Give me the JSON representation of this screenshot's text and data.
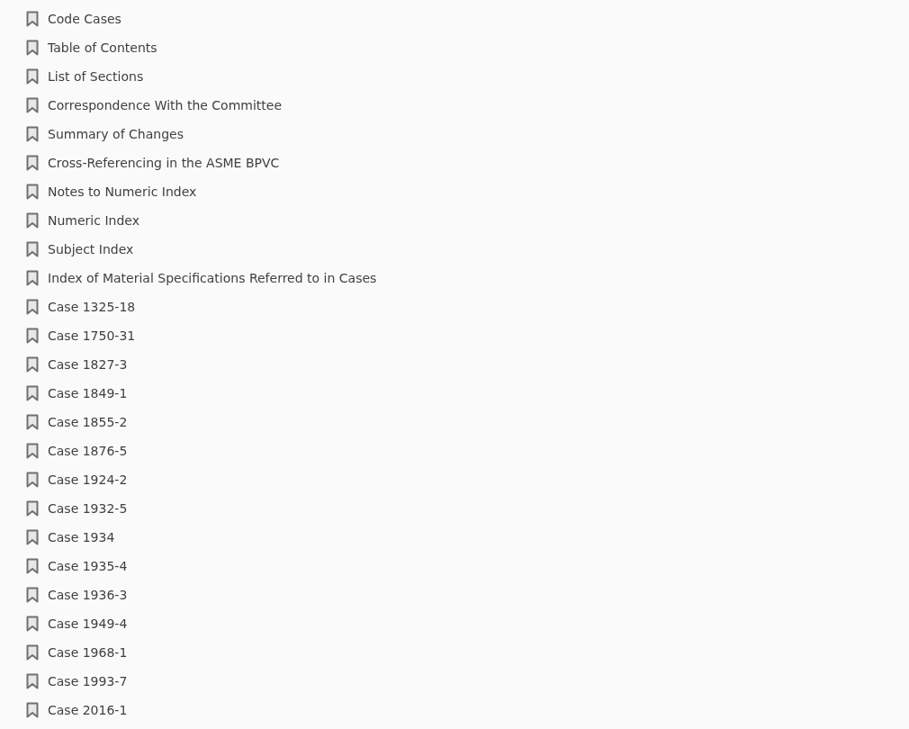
{
  "bookmarks": [
    {
      "label": "Code Cases"
    },
    {
      "label": "Table of Contents"
    },
    {
      "label": "List of Sections"
    },
    {
      "label": "Correspondence With the Committee"
    },
    {
      "label": "Summary of Changes"
    },
    {
      "label": "Cross-Referencing in the ASME BPVC"
    },
    {
      "label": "Notes to Numeric Index"
    },
    {
      "label": "Numeric Index"
    },
    {
      "label": "Subject Index"
    },
    {
      "label": "Index of Material Specifications Referred to in Cases"
    },
    {
      "label": "Case 1325-18"
    },
    {
      "label": "Case 1750-31"
    },
    {
      "label": "Case 1827-3"
    },
    {
      "label": "Case 1849-1"
    },
    {
      "label": "Case 1855-2"
    },
    {
      "label": "Case 1876-5"
    },
    {
      "label": "Case 1924-2"
    },
    {
      "label": "Case 1932-5"
    },
    {
      "label": "Case 1934"
    },
    {
      "label": "Case 1935-4"
    },
    {
      "label": "Case 1936-3"
    },
    {
      "label": "Case 1949-4"
    },
    {
      "label": "Case 1968-1"
    },
    {
      "label": "Case 1993-7"
    },
    {
      "label": "Case 2016-1"
    }
  ]
}
